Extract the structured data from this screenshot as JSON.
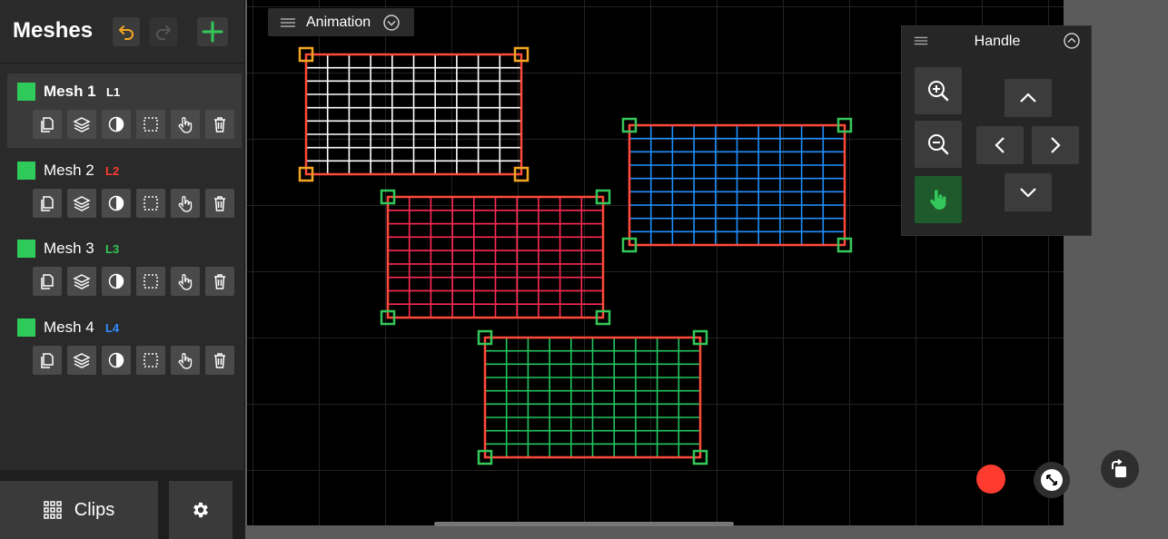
{
  "sidebar": {
    "title": "Meshes",
    "meshes": [
      {
        "name": "Mesh 1",
        "layer": "L1",
        "layer_color": "#ffffff",
        "selected": true
      },
      {
        "name": "Mesh 2",
        "layer": "L2",
        "layer_color": "#ff3b30",
        "selected": false
      },
      {
        "name": "Mesh 3",
        "layer": "L3",
        "layer_color": "#34c759",
        "selected": false
      },
      {
        "name": "Mesh 4",
        "layer": "L4",
        "layer_color": "#2f8cff",
        "selected": false
      }
    ],
    "tool_icons": [
      "duplicate-icon",
      "layers-icon",
      "contrast-icon",
      "select-icon",
      "hand-icon",
      "trash-icon"
    ],
    "clips_label": "Clips"
  },
  "toolbar": {
    "animation_label": "Animation"
  },
  "handle_panel": {
    "title": "Handle"
  },
  "colors": {
    "mesh_white": "#ffffff",
    "mesh_red": "#ff2a55",
    "mesh_blue": "#1f8fff",
    "mesh_green": "#22c55e",
    "border_red": "#ff4a3a",
    "handle_orange": "#f5a623",
    "handle_green": "#34c759",
    "record": "#ff3b30"
  }
}
